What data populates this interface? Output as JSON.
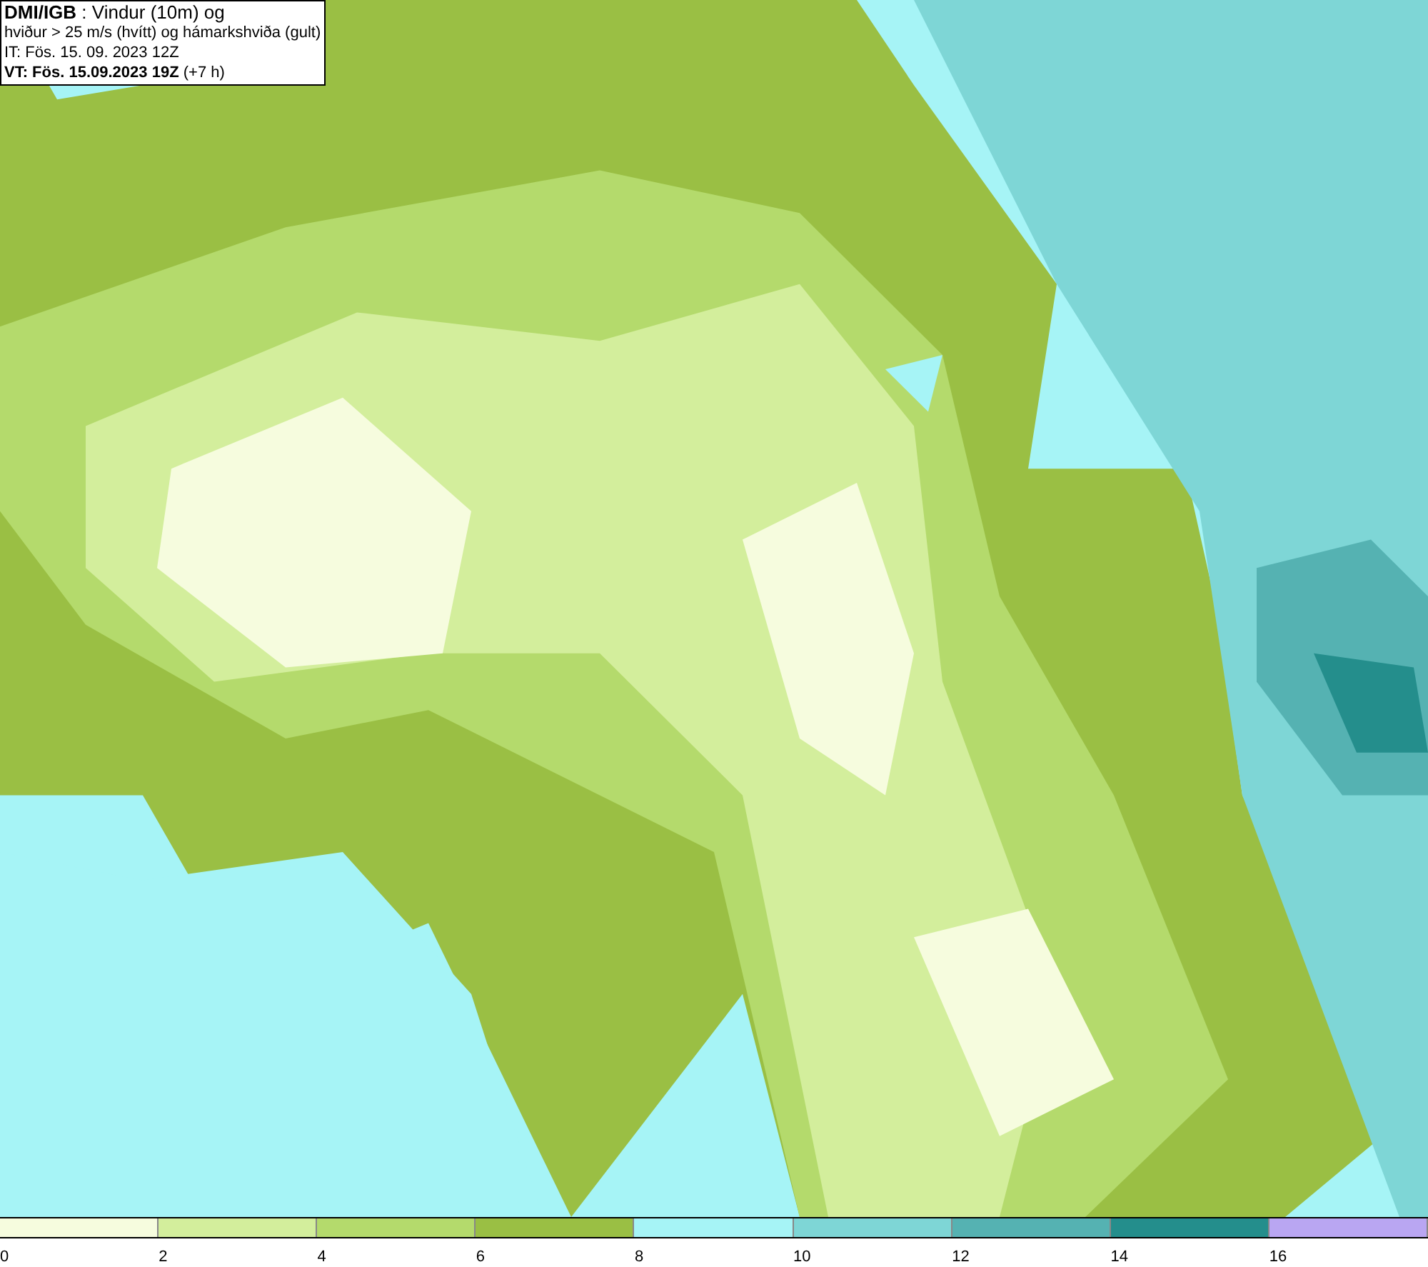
{
  "title_box": {
    "lines": [
      "**DMI/IGB** : Vindur (10m) og",
      "hviður > 25 m/s (hvítt) og hámarkshviða (gult)",
      "IT: Fös. 15. 09. 2023 12Z",
      "**VT: Fös. 15.09.2023 19Z** (+7 h)"
    ]
  },
  "legend": [
    {
      "label": "0",
      "color": "#f6fcde"
    },
    {
      "label": "2",
      "color": "#d3ee9c"
    },
    {
      "label": "4",
      "color": "#b4da6c"
    },
    {
      "label": "6",
      "color": "#9abf44"
    },
    {
      "label": "8",
      "color": "#a6f4f6"
    },
    {
      "label": "10",
      "color": "#7ed6d6"
    },
    {
      "label": "12",
      "color": "#55b2b2"
    },
    {
      "label": "14",
      "color": "#248e8c"
    },
    {
      "label": "16",
      "color": "#b9a6f2"
    }
  ]
}
